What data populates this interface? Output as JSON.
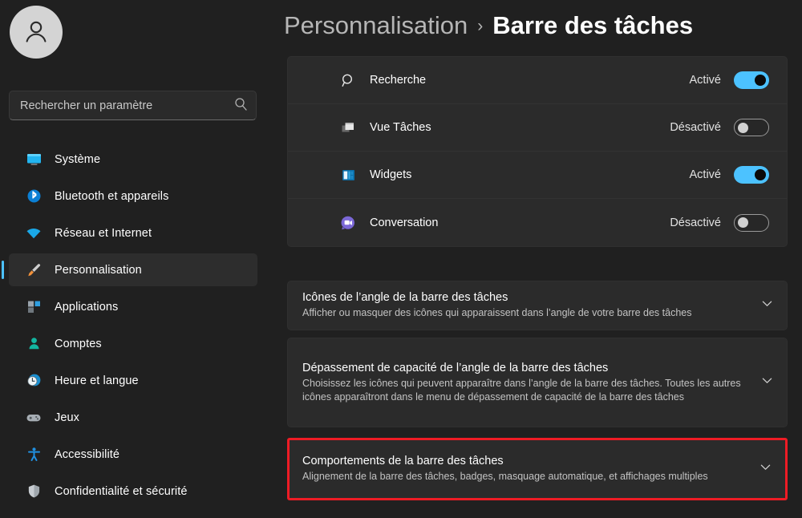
{
  "sidebar": {
    "avatar_icon": "user-avatar-icon",
    "search": {
      "placeholder": "Rechercher un paramètre",
      "value": "",
      "icon": "search-icon"
    },
    "items": [
      {
        "label": "Système",
        "icon": "monitor-icon",
        "selected": false
      },
      {
        "label": "Bluetooth et appareils",
        "icon": "bluetooth-icon",
        "selected": false
      },
      {
        "label": "Réseau et Internet",
        "icon": "wifi-icon",
        "selected": false
      },
      {
        "label": "Personnalisation",
        "icon": "paintbrush-icon",
        "selected": true
      },
      {
        "label": "Applications",
        "icon": "apps-icon",
        "selected": false
      },
      {
        "label": "Comptes",
        "icon": "account-icon",
        "selected": false
      },
      {
        "label": "Heure et langue",
        "icon": "clock-globe-icon",
        "selected": false
      },
      {
        "label": "Jeux",
        "icon": "gamepad-icon",
        "selected": false
      },
      {
        "label": "Accessibilité",
        "icon": "accessibility-icon",
        "selected": false
      },
      {
        "label": "Confidentialité et sécurité",
        "icon": "shield-icon",
        "selected": false
      }
    ]
  },
  "header": {
    "parent": "Personnalisation",
    "separator": "›",
    "current": "Barre des tâches"
  },
  "toggles": [
    {
      "label": "Recherche",
      "icon": "search-icon",
      "state": "Activé",
      "on": true
    },
    {
      "label": "Vue Tâches",
      "icon": "task-view-icon",
      "state": "Désactivé",
      "on": false
    },
    {
      "label": "Widgets",
      "icon": "widgets-icon",
      "state": "Activé",
      "on": true
    },
    {
      "label": "Conversation",
      "icon": "chat-icon",
      "state": "Désactivé",
      "on": false
    }
  ],
  "expanders": [
    {
      "title": "Icônes de l’angle de la barre des tâches",
      "description": "Afficher ou masquer des icônes qui apparaissent dans l’angle de votre barre des tâches",
      "chevron": "chevron-down-icon",
      "highlighted": false
    },
    {
      "title": "Dépassement de capacité de l’angle de la barre des tâches",
      "description": "Choisissez les icônes qui peuvent apparaître dans l’angle de la barre des tâches. Toutes les autres icônes apparaîtront dans le menu de dépassement de capacité de la barre des tâches",
      "chevron": "chevron-down-icon",
      "highlighted": false
    },
    {
      "title": "Comportements de la barre des tâches",
      "description": "Alignement de la barre des tâches, badges, masquage automatique, et affichages multiples",
      "chevron": "chevron-down-icon",
      "highlighted": true
    }
  ],
  "colors": {
    "accent": "#4cc2ff",
    "highlight_border": "#ee1c25",
    "page_background": "#202020",
    "card_background": "#2b2b2b"
  }
}
